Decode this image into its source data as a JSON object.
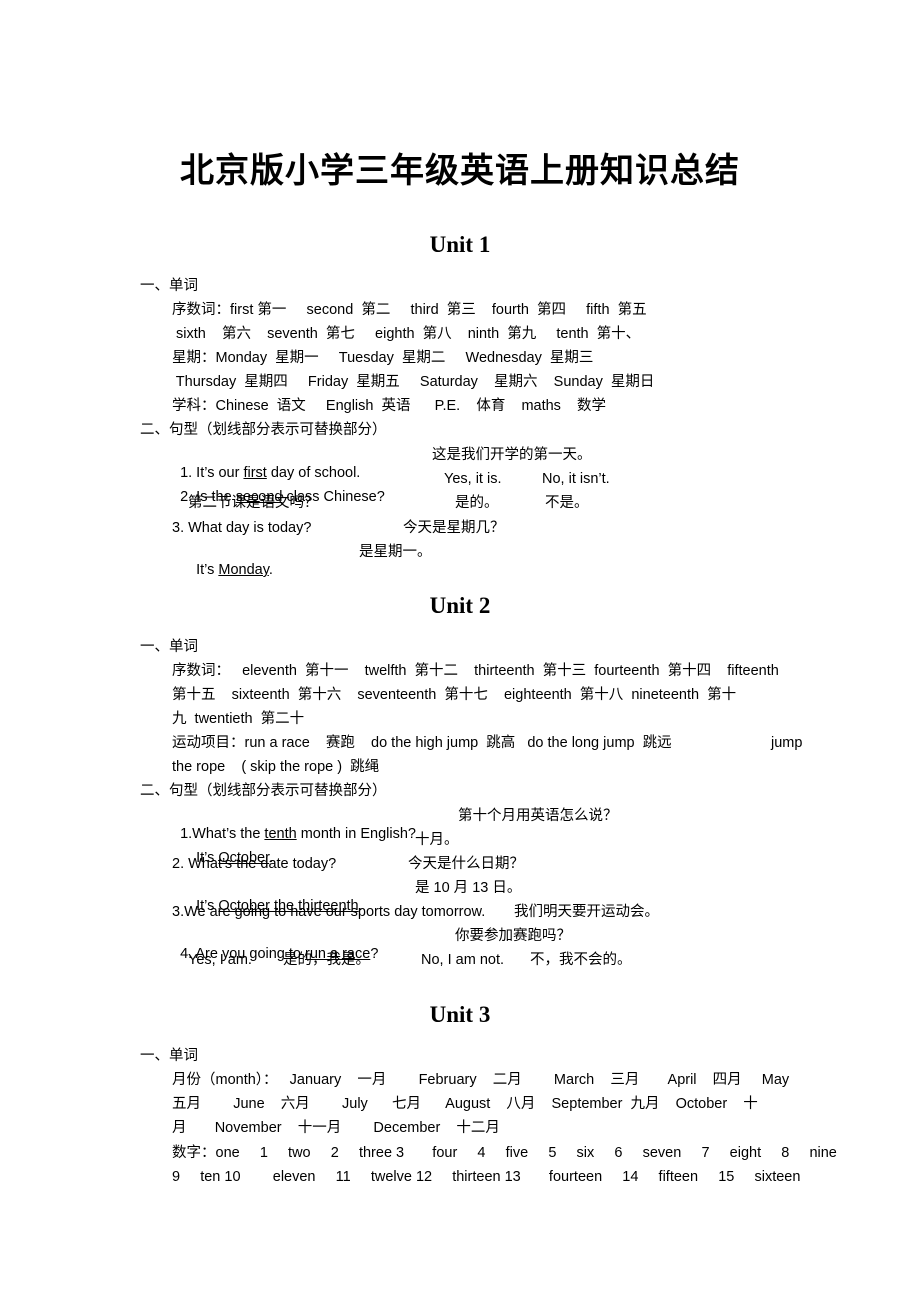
{
  "title": "北京版小学三年级英语上册知识总结",
  "units": [
    {
      "heading": "Unit 1",
      "vocab_heading": "一、单词",
      "vocab_lines": [
        "序数词：first 第一     second  第二     third  第三    fourth  第四     fifth  第五",
        " sixth    第六    seventh  第七     eighth  第八    ninth  第九     tenth  第十、",
        "星期：Monday  星期一     Tuesday  星期二     Wednesday  星期三",
        " Thursday  星期四     Friday  星期五     Saturday    星期六    Sunday  星期日",
        "学科：Chinese  语文     English  英语      P.E.    体育    maths    数学"
      ],
      "sentence_heading": "二、句型（划线部分表示可替换部分）",
      "sentences": [
        {
          "pre": "1. It’s our ",
          "u": "first",
          "post": " day of school.",
          "cn": "这是我们开学的第一天。"
        },
        {
          "pre": "2. Is the ",
          "u": "second",
          "post": " class Chinese?",
          "yes": "Yes, it is.",
          "no": "No, it isn’t."
        },
        {
          "cn_q": "第二节课是语文吗？",
          "cn_yes": "是的。",
          "cn_no": "不是。"
        },
        {
          "pre": "3. What day is today?",
          "cn": "今天是星期几？"
        },
        {
          "pre": "It’s ",
          "u": "Monday",
          "post": ".",
          "cn": "是星期一。"
        }
      ]
    },
    {
      "heading": "Unit 2",
      "vocab_heading": "一、单词",
      "vocab_lines": [
        "序数词：   eleventh  第十一    twelfth  第十二    thirteenth  第十三  fourteenth  第十四    fifteenth",
        "第十五    sixteenth  第十六    seventeenth  第十七    eighteenth  第十八  nineteenth  第十",
        "九  twentieth  第二十",
        "运动项目：run a race    赛跑    do the high jump  跳高   do the long jump  跳远",
        "the rope    ( skip the rope )  跳绳"
      ],
      "vocab_extra": "jump",
      "sentence_heading": "二、句型（划线部分表示可替换部分）",
      "sentences": [
        {
          "pre": "1.What’s the ",
          "u": "tenth",
          "post": " month in English?",
          "cn": "第十个月用英语怎么说？"
        },
        {
          "pre": "It’s ",
          "u": "October",
          "post": ".",
          "cn": "十月。"
        },
        {
          "pre": "2. What’s the date today?",
          "cn": "今天是什么日期？"
        },
        {
          "pre": "It’s ",
          "u": "October the thirteenth",
          "post": ".",
          "cn": "是 10 月 13 日。"
        },
        {
          "pre": "3.We are going to have our sports day tomorrow.",
          "cn": "我们明天要开运动会。"
        },
        {
          "pre": "4. Are you going to ",
          "u": "run a race",
          "post": "?",
          "cn": "你要参加赛跑吗？"
        },
        {
          "pre": "Yes, I am.",
          "cn": "是的，我是。",
          "no": "No, I am not.",
          "cn_no": "不，我不会的。"
        }
      ]
    },
    {
      "heading": "Unit 3",
      "vocab_heading": "一、单词",
      "vocab_lines": [
        "月份（month）：   January    一月        February    二月        March    三月       April    四月     May",
        "五月        June    六月        July      七月      August    八月    September  九月    October    十",
        "月       November    十一月        December    十二月",
        "数字：one     1     two     2     three 3       four     4     five     5     six     6     seven     7     eight     8     nine",
        "9     ten 10        eleven     11     twelve 12     thirteen 13       fourteen     14     fifteen     15     sixteen"
      ]
    }
  ]
}
